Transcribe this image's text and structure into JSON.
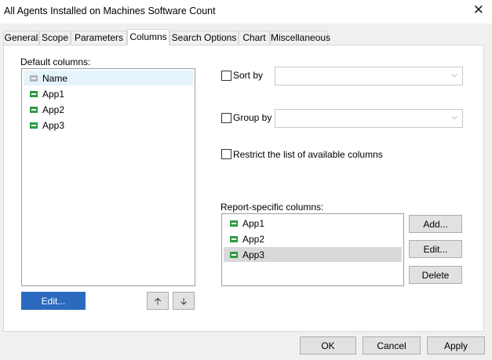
{
  "window": {
    "title": "All Agents Installed on Machines Software Count",
    "close_glyph": "✕"
  },
  "tabs": [
    {
      "label": "General"
    },
    {
      "label": "Scope"
    },
    {
      "label": "Parameters"
    },
    {
      "label": "Columns"
    },
    {
      "label": "Search Options"
    },
    {
      "label": "Chart"
    },
    {
      "label": "Miscellaneous"
    }
  ],
  "default_columns": {
    "label": "Default columns:",
    "items": [
      {
        "label": "Name",
        "icon": "column-grey-icon"
      },
      {
        "label": "App1",
        "icon": "column-green-icon"
      },
      {
        "label": "App2",
        "icon": "column-green-icon"
      },
      {
        "label": "App3",
        "icon": "column-green-icon"
      }
    ],
    "edit_label": "Edit...",
    "up_glyph": "🡡",
    "down_glyph": "🡣"
  },
  "sort_by": {
    "label": "Sort by",
    "value": ""
  },
  "group_by": {
    "label": "Group by",
    "value": ""
  },
  "restrict": {
    "label": "Restrict the list of available columns"
  },
  "report_columns": {
    "label": "Report-specific columns:",
    "items": [
      {
        "label": "App1",
        "icon": "column-green-icon"
      },
      {
        "label": "App2",
        "icon": "column-green-icon"
      },
      {
        "label": "App3",
        "icon": "column-green-icon"
      }
    ],
    "add_label": "Add...",
    "edit_label": "Edit...",
    "delete_label": "Delete"
  },
  "footer": {
    "ok": "OK",
    "cancel": "Cancel",
    "apply": "Apply"
  },
  "colors": {
    "accent": "#2a6bbf",
    "icon_green": "#2e9b45"
  }
}
